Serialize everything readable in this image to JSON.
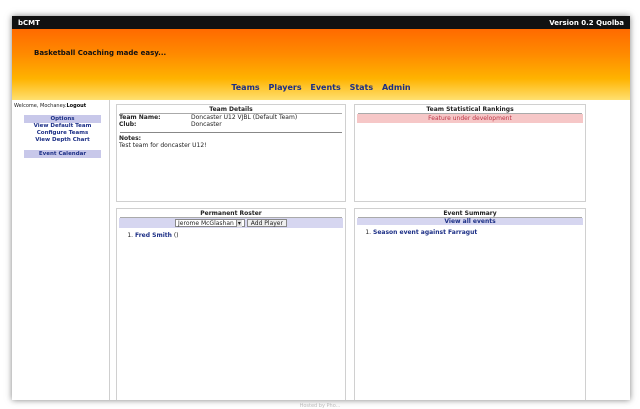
{
  "app": {
    "title": "bCMT",
    "version": "Version 0.2 Quolba",
    "tagline": "Basketball Coaching made easy..."
  },
  "nav": [
    "Teams",
    "Players",
    "Events",
    "Stats",
    "Admin"
  ],
  "sidebar": {
    "welcome_prefix": "Welcome, Mochaney.",
    "logout": "Logout",
    "options_head": "Options",
    "options": [
      "View Default Team",
      "Configure Teams",
      "View Depth Chart"
    ],
    "calendar_head": "Event Calendar"
  },
  "team_details": {
    "title": "Team Details",
    "name_label": "Team Name:",
    "name_value": "Doncaster U12 VJBL (Default Team)",
    "club_label": "Club:",
    "club_value": "Doncaster",
    "notes_label": "Notes:",
    "notes_value": "Test team for doncaster U12!"
  },
  "rankings": {
    "title": "Team Statistical Rankings",
    "message": "Feature under development"
  },
  "roster": {
    "title": "Permanent Roster",
    "select_value": "Jerome McGlashan",
    "add_button": "Add Player",
    "players": [
      {
        "name": "Fred Smith",
        "suffix": " ()"
      }
    ]
  },
  "events": {
    "title": "Event Summary",
    "view_all": "View all events",
    "items": [
      "Season event against Farragut"
    ]
  },
  "footer": "Hosted by Pho..."
}
